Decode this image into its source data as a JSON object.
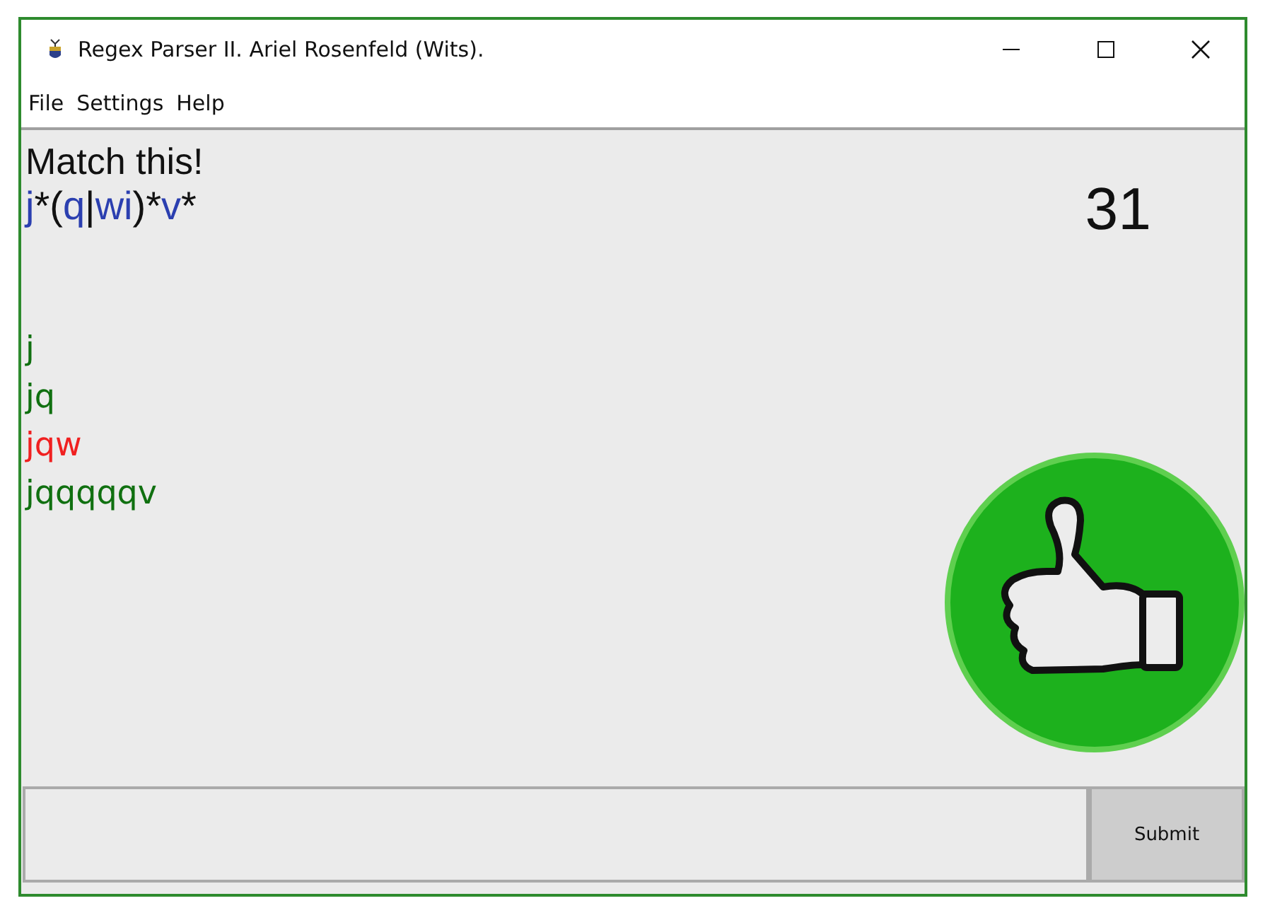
{
  "window": {
    "title": "Regex Parser II. Ariel Rosenfeld (Wits)."
  },
  "menu": [
    "File",
    "Settings",
    "Help"
  ],
  "prompt": "Match this!",
  "regex": [
    {
      "text": "j",
      "kind": "literal"
    },
    {
      "text": "*(",
      "kind": "operator"
    },
    {
      "text": "q",
      "kind": "literal"
    },
    {
      "text": "|",
      "kind": "operator"
    },
    {
      "text": "wi",
      "kind": "literal"
    },
    {
      "text": ")*",
      "kind": "operator"
    },
    {
      "text": "v",
      "kind": "literal"
    },
    {
      "text": "*",
      "kind": "operator"
    }
  ],
  "score": "31",
  "attempts": [
    {
      "text": "j",
      "correct": true
    },
    {
      "text": "jq",
      "correct": true
    },
    {
      "text": "jqw",
      "correct": false
    },
    {
      "text": "jqqqqqv",
      "correct": true
    }
  ],
  "feedback": {
    "kind": "thumbs_up"
  },
  "submit": "Submit"
}
